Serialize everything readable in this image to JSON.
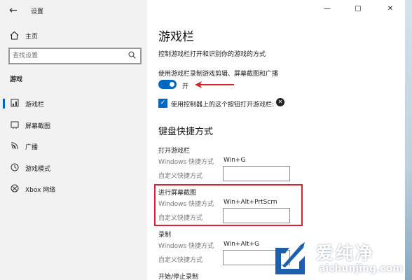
{
  "window": {
    "title": "设置"
  },
  "sidebar": {
    "home": "主页",
    "search_placeholder": "查找设置",
    "section": "游戏",
    "items": [
      {
        "label": "游戏栏",
        "icon": "game-bar-icon"
      },
      {
        "label": "屏幕截图",
        "icon": "capture-icon"
      },
      {
        "label": "广播",
        "icon": "broadcast-icon"
      },
      {
        "label": "游戏模式",
        "icon": "game-mode-icon"
      },
      {
        "label": "Xbox 网络",
        "icon": "xbox-icon"
      }
    ]
  },
  "main": {
    "title": "游戏栏",
    "description": "控制游戏栏打开和识别你的游戏的方式",
    "record_label": "使用游戏栏录制游戏剪辑、屏幕截图和广播",
    "toggle_state": "开",
    "checkbox_label": "使用控制器上的这个按钮打开游戏栏:",
    "shortcuts_title": "键盘快捷方式",
    "groups": [
      {
        "title": "打开游戏栏",
        "windows_key": "Windows 快捷方式",
        "windows_value": "Win+G",
        "custom_key": "自定义快捷方式"
      },
      {
        "title": "进行屏幕截图",
        "windows_key": "Windows 快捷方式",
        "windows_value": "Win+Alt+PrtScrn",
        "custom_key": "自定义快捷方式"
      },
      {
        "title": "录制",
        "windows_key": "Windows 快捷方式",
        "windows_value": "Win+Alt+G",
        "custom_key": "自定义快捷方式"
      },
      {
        "title": "开始/停止录制"
      }
    ]
  },
  "watermark": {
    "cn": "爱纯净",
    "en": "aichunjing.com"
  },
  "colors": {
    "accent": "#0067c0",
    "highlight": "#d9232e"
  }
}
